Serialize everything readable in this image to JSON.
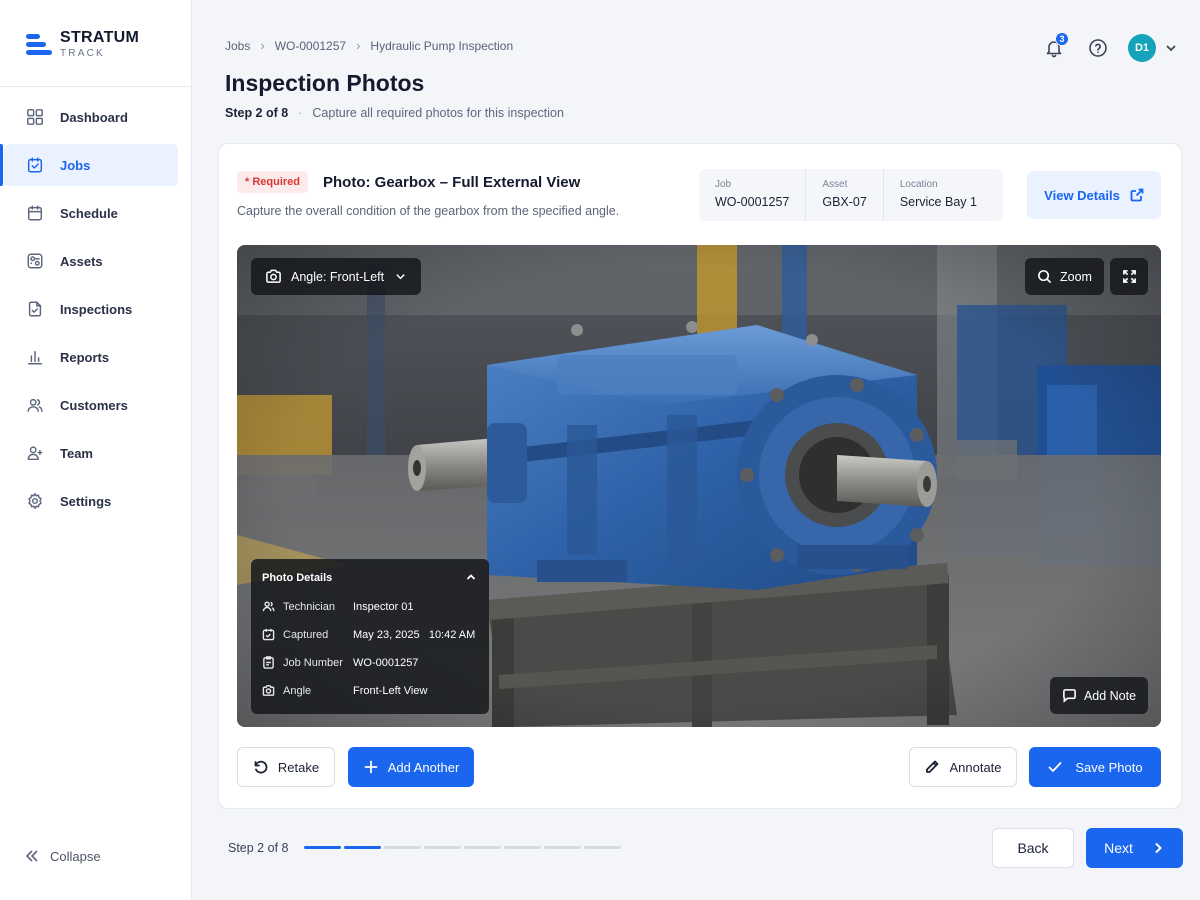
{
  "app": {
    "name_line1": "STRATUM",
    "name_line2": "TRACK"
  },
  "sidebar": {
    "items": [
      {
        "label": "Dashboard",
        "icon": "grid-icon"
      },
      {
        "label": "Jobs",
        "icon": "calendar-check-icon",
        "active": true
      },
      {
        "label": "Schedule",
        "icon": "calendar-icon"
      },
      {
        "label": "Assets",
        "icon": "assets-icon"
      },
      {
        "label": "Inspections",
        "icon": "clipboard-check-icon"
      },
      {
        "label": "Reports",
        "icon": "bar-chart-icon"
      },
      {
        "label": "Customers",
        "icon": "users-icon"
      },
      {
        "label": "Team",
        "icon": "team-icon"
      },
      {
        "label": "Settings",
        "icon": "gear-icon"
      }
    ],
    "collapse_label": "Collapse"
  },
  "header": {
    "breadcrumb": [
      "Jobs",
      "WO-0001257",
      "Hydraulic Pump Inspection"
    ],
    "title": "Inspection Photos",
    "step_label": "Step 2 of 8",
    "step_separator": "·",
    "step_desc": "Capture all required photos for this inspection",
    "notification_count": "3",
    "avatar_initials": "D1"
  },
  "card": {
    "required_badge": "* Required",
    "photo_title": "Photo: Gearbox – Full External View",
    "photo_desc": "Capture the overall condition of the gearbox from the specified angle.",
    "info": {
      "job_label": "Job",
      "job_value": "WO-0001257",
      "asset_label": "Asset",
      "asset_value": "GBX-07",
      "location_label": "Location",
      "location_value": "Service Bay 1"
    },
    "view_details_label": "View Details"
  },
  "photo": {
    "angle_label": "Angle: Front-Left",
    "zoom_label": "Zoom",
    "add_note_label": "Add Note",
    "details": {
      "title": "Photo Details",
      "technician_label": "Technician",
      "technician_value": "Inspector 01",
      "captured_label": "Captured",
      "captured_value": "May 23, 2025   10:42 AM",
      "job_number_label": "Job Number",
      "job_number_value": "WO-0001257",
      "angle_label": "Angle",
      "angle_value": "Front-Left View"
    }
  },
  "actions": {
    "retake": "Retake",
    "add_another": "Add Another",
    "annotate": "Annotate",
    "save_photo": "Save Photo"
  },
  "footer": {
    "step_label": "Step 2 of 8",
    "steps_total": 8,
    "steps_done": 2,
    "back_label": "Back",
    "next_label": "Next"
  },
  "colors": {
    "accent": "#1a66ee",
    "required": "#d93636",
    "avatar": "#14a3b8"
  }
}
